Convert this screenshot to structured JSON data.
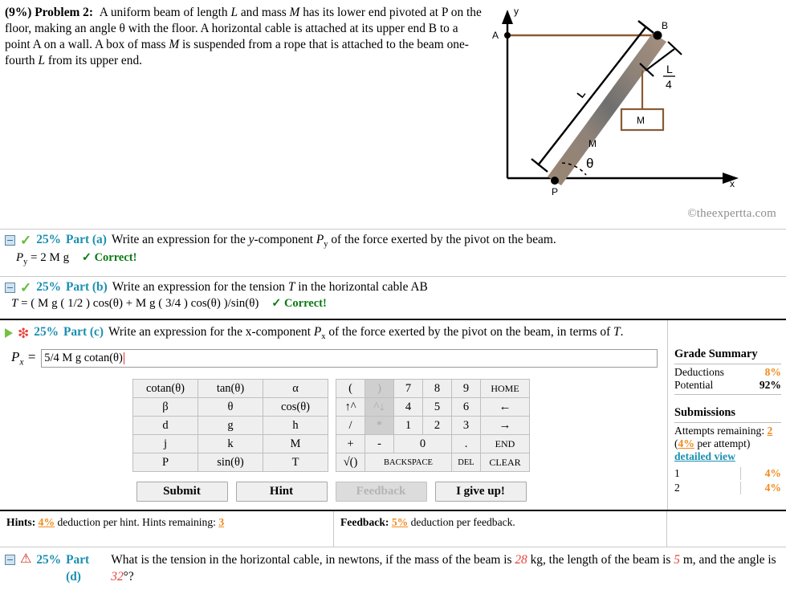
{
  "problem": {
    "percent": "(9%)",
    "label": "Problem 2:",
    "line1_a": "A uniform beam of length ",
    "var_L": "L",
    "line1_b": " and mass ",
    "var_M": "M",
    "line1_c": " has its lower end pivoted at P",
    "line2": "on the floor, making an angle θ with the floor. A horizontal cable is attached at its upper",
    "line3_a": "end B to a point A on a wall. A box of mass ",
    "line3_b": " is suspended from a rope that is attached to",
    "line4_a": "the beam one-fourth ",
    "line4_b": " from its upper end."
  },
  "figure": {
    "axis_y": "y",
    "axis_x": "x",
    "point_a": "A",
    "point_b": "B",
    "point_p": "P",
    "beam_mass": "M",
    "box_mass": "M",
    "dim_numer": "L",
    "dim_denom": "4",
    "angle": "θ",
    "watermark": "©theexpertta.com",
    "colors": {
      "cable": "#8a5a33",
      "beam_light": "#a08b77",
      "beam_dark": "#6b6b6b",
      "axis": "#000000"
    }
  },
  "parts": [
    {
      "pct": "25%",
      "name": "Part (a)",
      "status_icon": "check-icon",
      "toggle_icon": "collapse-box-icon",
      "prompt_pre": "Write an expression for the ",
      "prompt_var": "y",
      "prompt_mid": "-component ",
      "prompt_sym": "P",
      "prompt_sub": "y",
      "prompt_post": " of the force exerted by the pivot on the beam.",
      "answer_label": "P",
      "answer_sub": "y",
      "answer_value": "= 2 M g",
      "status_text": "✓ Correct!"
    },
    {
      "pct": "25%",
      "name": "Part (b)",
      "status_icon": "check-icon",
      "toggle_icon": "collapse-box-icon",
      "prompt_pre": "Write an expression for the tension ",
      "prompt_var": "T",
      "prompt_post": " in the horizontal cable AB",
      "answer_label": "T",
      "answer_value": "= ( M g ( 1/2 ) cos(θ) + M g ( 3/4 ) cos(θ) )/sin(θ)",
      "status_text": "✓ Correct!"
    }
  ],
  "part_c": {
    "pct": "25%",
    "name": "Part (c)",
    "status_icon": "red-star-icon",
    "toggle_icon": "expand-triangle-icon",
    "prompt_pre": "Write an expression for the x-component ",
    "prompt_sym": "P",
    "prompt_sub": "x",
    "prompt_mid": " of the force exerted by the pivot on the beam, in terms of ",
    "prompt_var": "T",
    "prompt_post": ".",
    "answer_label_sym": "P",
    "answer_label_sub": "x",
    "answer_eq": "=",
    "input_value": "5/4 M g cotan(θ)",
    "input_placeholder": ""
  },
  "keypad": {
    "left_rows": [
      [
        "cotan(θ)",
        "tan(θ)",
        "α"
      ],
      [
        "β",
        "θ",
        "cos(θ)"
      ],
      [
        "d",
        "g",
        "h"
      ],
      [
        "j",
        "k",
        "M"
      ],
      [
        "P",
        "sin(θ)",
        "T"
      ]
    ],
    "right_rows": [
      [
        "(",
        ")",
        "7",
        "8",
        "9",
        "HOME"
      ],
      [
        "↑^",
        "^↓",
        "4",
        "5",
        "6",
        "←"
      ],
      [
        "/",
        "*",
        "1",
        "2",
        "3",
        "→"
      ],
      [
        "+",
        "-",
        "0",
        ".",
        "END"
      ],
      [
        "√()",
        "BACKSPACE",
        "DEL",
        "CLEAR"
      ]
    ],
    "disabled_keys": [
      ")",
      "^↓",
      "*"
    ]
  },
  "buttons": {
    "submit": "Submit",
    "hint": "Hint",
    "feedback": "Feedback",
    "giveup": "I give up!"
  },
  "grade_summary": {
    "title": "Grade Summary",
    "deductions_label": "Deductions",
    "deductions_value": "8%",
    "potential_label": "Potential",
    "potential_value": "92%",
    "submissions_title": "Submissions",
    "attempts_label": "Attempts remaining:",
    "attempts_value": "2",
    "per_attempt_open": "(",
    "per_attempt_value": "4%",
    "per_attempt_rest": " per attempt)",
    "detailed_view": "detailed view",
    "rows": [
      {
        "n": "1",
        "pct": "4%"
      },
      {
        "n": "2",
        "pct": "4%"
      }
    ]
  },
  "hints_bar": {
    "hints_label": "Hints:",
    "hints_pct": "4%",
    "hints_text": "deduction per hint. Hints remaining:",
    "hints_remaining": "3",
    "feedback_label": "Feedback:",
    "feedback_pct": "5%",
    "feedback_text": "deduction per feedback."
  },
  "part_d": {
    "pct": "25%",
    "name": "Part (d)",
    "status_icon": "warning-icon",
    "toggle_icon": "collapse-box-icon",
    "t1": "What is the tension in the horizontal cable, in newtons, if the mass of the beam is ",
    "v_mass": "28",
    "t2": " kg, the length of the beam is ",
    "v_len": "5",
    "t3": " m, and the",
    "t4": "angle is ",
    "v_ang": "32",
    "t5": "°?"
  }
}
